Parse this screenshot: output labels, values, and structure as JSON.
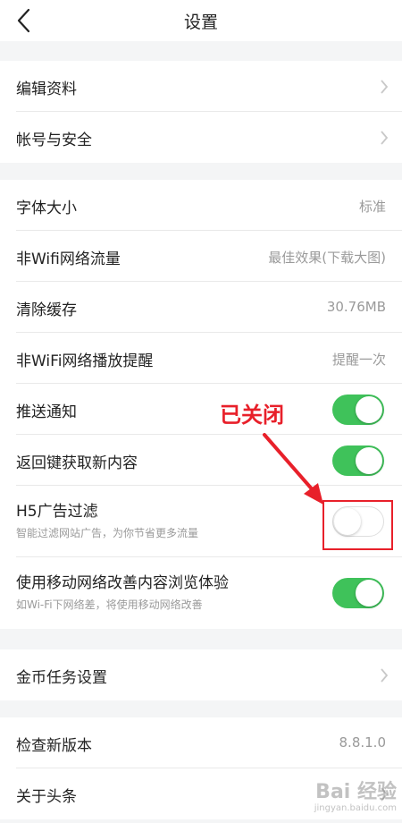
{
  "header": {
    "title": "设置"
  },
  "groups": {
    "profile": {
      "edit_profile": "编辑资料",
      "account_security": "帐号与安全"
    },
    "general": {
      "font_size_label": "字体大小",
      "font_size_value": "标准",
      "non_wifi_traffic_label": "非Wifi网络流量",
      "non_wifi_traffic_value": "最佳效果(下载大图)",
      "clear_cache_label": "清除缓存",
      "clear_cache_value": "30.76MB",
      "non_wifi_play_reminder_label": "非WiFi网络播放提醒",
      "non_wifi_play_reminder_value": "提醒一次",
      "push_notification_label": "推送通知",
      "push_notification_on": true,
      "back_key_refresh_label": "返回键获取新内容",
      "back_key_refresh_on": true,
      "h5_ad_filter_label": "H5广告过滤",
      "h5_ad_filter_sub": "智能过滤网站广告，为你节省更多流量",
      "h5_ad_filter_on": false,
      "mobile_network_improve_label": "使用移动网络改善内容浏览体验",
      "mobile_network_improve_sub": "如Wi-Fi下网络差，将使用移动网络改善",
      "mobile_network_improve_on": true
    },
    "tasks": {
      "coin_task_settings": "金币任务设置"
    },
    "about": {
      "check_update_label": "检查新版本",
      "check_update_value": "8.8.1.0",
      "about_toutiao": "关于头条"
    }
  },
  "annotation": {
    "text": "已关闭",
    "color": "#e8202a"
  },
  "watermark": {
    "brand": "Bai 经验",
    "domain": "jingyan.baidu.com"
  },
  "colors": {
    "toggle_on": "#3fc25a",
    "background": "#f4f5f6"
  }
}
